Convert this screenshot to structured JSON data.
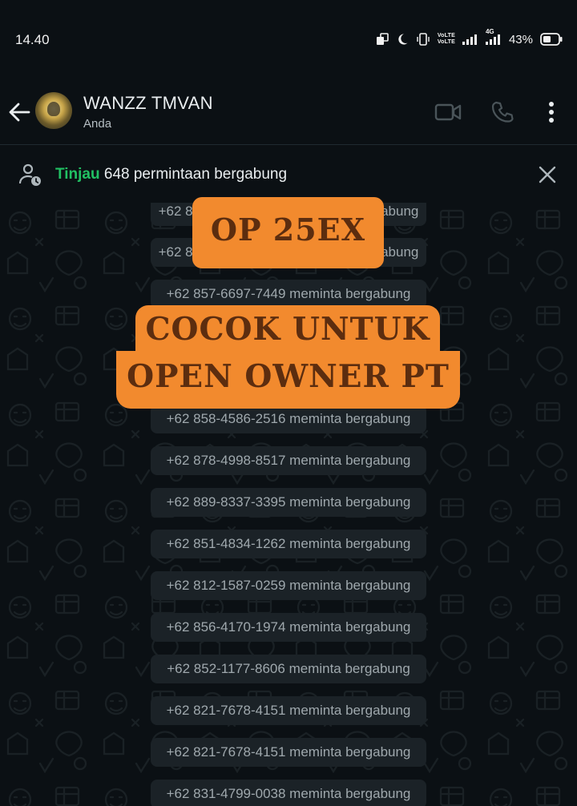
{
  "status_bar": {
    "time": "14.40",
    "volte1": "VoLTE",
    "volte2": "VoLTE",
    "network": "4G",
    "battery": "43%"
  },
  "header": {
    "name": "WANZZ TMVAN",
    "subtitle": "Anda",
    "icons": [
      "back-arrow-icon",
      "video-call-icon",
      "phone-call-icon",
      "more-vert-icon"
    ]
  },
  "banner": {
    "link": "Tinjau",
    "text": " 648 permintaan bergabung"
  },
  "messages": [
    "+62 8",
    "+62 8",
    "+62 857-6697-7449 meminta bergabung",
    "+62 858-4586-2516 meminta bergabung",
    "+62 878-4998-8517 meminta bergabung",
    "+62 889-8337-3395 meminta bergabung",
    "+62 851-4834-1262 meminta bergabung",
    "+62 812-1587-0259 meminta bergabung",
    "+62 856-4170-1974 meminta bergabung",
    "+62 852-1177-8606 meminta bergabung",
    "+62 821-7678-4151 meminta bergabung",
    "+62 821-7678-4151 meminta bergabung",
    "+62 831-4799-0038 meminta bergabung"
  ],
  "message_tails": [
    "gabung",
    "gabung"
  ],
  "overlay": {
    "line1": "OP 25EX",
    "line2": "COCOK UNTUK",
    "line3": "OPEN OWNER PT"
  },
  "colors": {
    "background": "#0b1014",
    "accent_green": "#21c063",
    "system_bubble": "#1b2227",
    "overlay_orange": "#f28a2e",
    "overlay_text": "#5c2d0f"
  }
}
